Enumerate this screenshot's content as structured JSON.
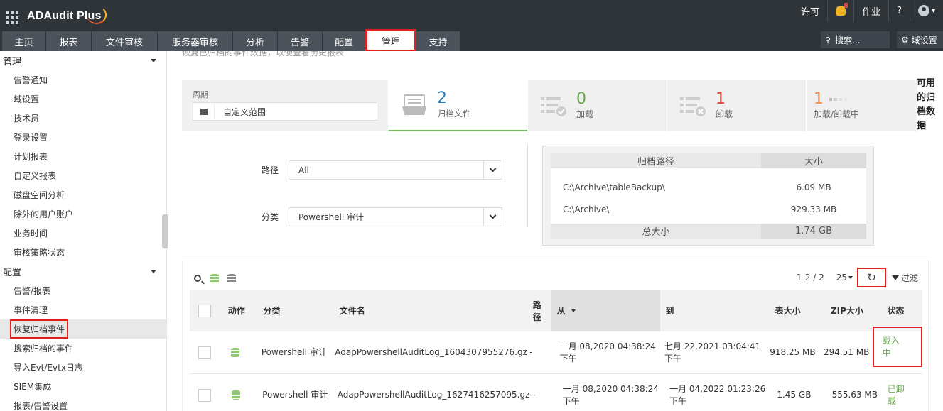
{
  "header": {
    "app_title": "ADAudit Plus",
    "license": "许可",
    "notification_count": "8",
    "jobs": "作业",
    "help": "?",
    "caret": "▾"
  },
  "nav": {
    "tabs": [
      "主页",
      "报表",
      "文件审核",
      "服务器审核",
      "分析",
      "告警",
      "配置",
      "管理",
      "支持"
    ],
    "active_tab": "管理",
    "search_placeholder": "搜索...",
    "domain_settings": "域设置"
  },
  "sidebar": {
    "sections": [
      {
        "title": "管理",
        "items": [
          "告警通知",
          "域设置",
          "技术员",
          "登录设置",
          "计划报表",
          "自定义报表",
          "磁盘空间分析",
          "除外的用户账户",
          "业务时间",
          "审核策略状态"
        ]
      },
      {
        "title": "配置",
        "items": [
          "告警/报表",
          "事件清理",
          "恢复归档事件",
          "搜索归档的事件",
          "导入Evt/Evtx日志",
          "SIEM集成",
          "报表/告警设置"
        ]
      }
    ],
    "active_item": "恢复归档事件"
  },
  "main": {
    "cut_description": "恢复已归档的事件数据，以便查看历史报表",
    "period": {
      "label": "周期",
      "value": "自定义范围"
    },
    "stats": [
      {
        "count": "2",
        "label": "归档文件",
        "color": "#2e7fb8"
      },
      {
        "count": "0",
        "label": "加载",
        "color": "#6aa84f"
      },
      {
        "count": "1",
        "label": "卸载",
        "color": "#e0443a"
      },
      {
        "count": "1",
        "label": "加载/卸载中",
        "color": "#f28b50"
      }
    ],
    "available_data": "可用的归档数据",
    "filters": {
      "path_label": "路径",
      "path_value": "All",
      "category_label": "分类",
      "category_value": "Powershell 审计"
    },
    "archive_paths": {
      "col_path": "归档路径",
      "col_size": "大小",
      "rows": [
        {
          "path": "C:\\Archive\\tableBackup\\",
          "size": "6.09 MB"
        },
        {
          "path": "C:\\Archive\\",
          "size": "929.33 MB"
        }
      ],
      "total_label": "总大小",
      "total_value": "1.74 GB"
    },
    "table": {
      "pagination": "1-2 / 2",
      "per_page": "25",
      "refresh_icon": "↻",
      "filter_label": "过滤",
      "columns": [
        "动作",
        "分类",
        "文件名",
        "路径",
        "从",
        "到",
        "表大小",
        "ZIP大小",
        "状态"
      ],
      "sorted_column": "从",
      "rows": [
        {
          "category": "Powershell 审计",
          "file": "AdapPowershellAuditLog_1604307955276.gz",
          "path": "-",
          "from": "一月 08,2020 04:38:24 下午",
          "to": "七月 22,2021 03:04:41 下午",
          "table_size": "918.25 MB",
          "zip_size": "294.51 MB",
          "status": "载入中"
        },
        {
          "category": "Powershell 审计",
          "file": "AdapPowershellAuditLog_1627416257095.gz",
          "path": "-",
          "from": "一月 08,2020 04:38:24 下午",
          "to": "一月 04,2022 01:23:26 下午",
          "table_size": "1.45 GB",
          "zip_size": "555.63 MB",
          "status": "已卸载"
        }
      ]
    }
  }
}
